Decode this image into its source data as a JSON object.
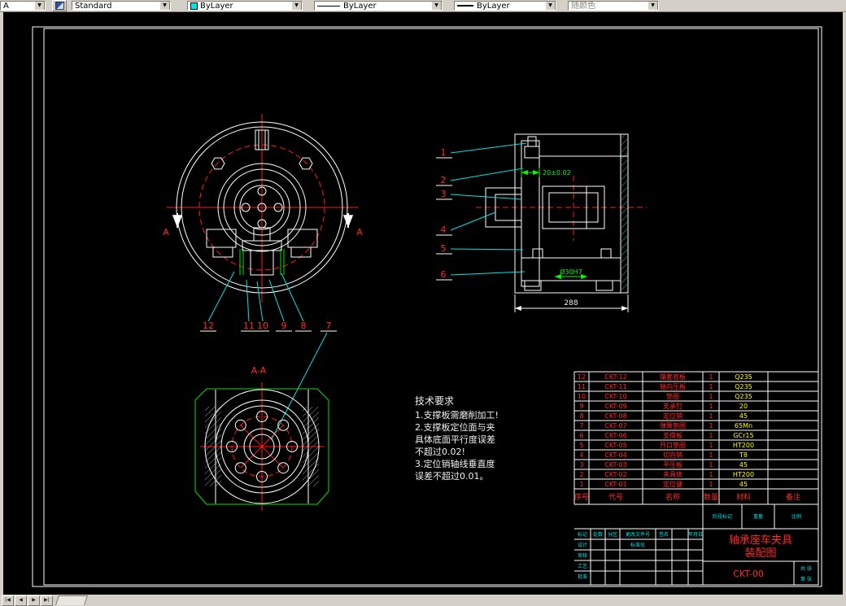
{
  "toolbar": {
    "style_combo": "A",
    "text_style": "Standard",
    "color": "ByLayer",
    "linetype": "ByLayer",
    "lineweight": "ByLayer",
    "plot_style": "随颜色"
  },
  "views": {
    "section_label_left": "A",
    "section_label_right": "A",
    "aa_label": "A-A"
  },
  "callouts": {
    "top": [
      "12",
      "11",
      "10",
      "9",
      "8",
      "7"
    ],
    "right": [
      "1",
      "2",
      "3",
      "4",
      "5",
      "6"
    ]
  },
  "dims": {
    "width": "288",
    "tol": "20±0.02",
    "bore": "Ø30H7"
  },
  "tech": {
    "title": "技术要求",
    "lines": [
      "1.支撑板需磨削加工!",
      "2.支撑板定位面与夹",
      "具体底面平行度误差",
      "不超过0.02!",
      "3.定位销轴线垂直度",
      "误差不超过0.01。"
    ]
  },
  "parts": {
    "headers": {
      "no": "序号",
      "code": "代号",
      "name": "名称",
      "qty": "数量",
      "material": "材料",
      "remark": "备注"
    },
    "rows": [
      {
        "no": "12",
        "code": "CKT-12",
        "name": "镶套底板",
        "qty": "1",
        "material": "Q235"
      },
      {
        "no": "11",
        "code": "CKT-11",
        "name": "轴向压板",
        "qty": "1",
        "material": "Q235"
      },
      {
        "no": "10",
        "code": "CKT-10",
        "name": "垫圈",
        "qty": "1",
        "material": "Q235"
      },
      {
        "no": "9",
        "code": "CKT-09",
        "name": "支承钉",
        "qty": "1",
        "material": "20"
      },
      {
        "no": "8",
        "code": "CKT-08",
        "name": "定位销",
        "qty": "1",
        "material": "45"
      },
      {
        "no": "7",
        "code": "CKT-07",
        "name": "弹簧垫圈",
        "qty": "1",
        "material": "65Mn"
      },
      {
        "no": "6",
        "code": "CKT-06",
        "name": "支撑板",
        "qty": "1",
        "material": "GCr15"
      },
      {
        "no": "5",
        "code": "CKT-05",
        "name": "开口垫圈",
        "qty": "1",
        "material": "HT200"
      },
      {
        "no": "4",
        "code": "CKT-04",
        "name": "切向销",
        "qty": "1",
        "material": "T8"
      },
      {
        "no": "3",
        "code": "CKT-03",
        "name": "平压板",
        "qty": "1",
        "material": "45"
      },
      {
        "no": "2",
        "code": "CKT-02",
        "name": "夹具体",
        "qty": "1",
        "material": "HT200"
      },
      {
        "no": "1",
        "code": "CKT-01",
        "name": "定位键",
        "qty": "1",
        "material": "45"
      }
    ]
  },
  "titleblock": {
    "title_line1": "轴承座车夹具",
    "title_line2": "装配图",
    "drawing_no": "CKT-00",
    "row_labels": [
      "标记",
      "处数",
      "分区",
      "更改文件号",
      "签名",
      "年月日"
    ],
    "sig_labels": [
      "设计",
      "审核",
      "工艺",
      "批准"
    ],
    "std_label": "标准化",
    "stage_labels": [
      "阶段标记",
      "重量",
      "比例"
    ],
    "sheet_labels": [
      "共 张",
      "第 张"
    ]
  },
  "statusbar": {
    "nav": [
      "|◀",
      "◀",
      "▶",
      "▶|"
    ]
  }
}
